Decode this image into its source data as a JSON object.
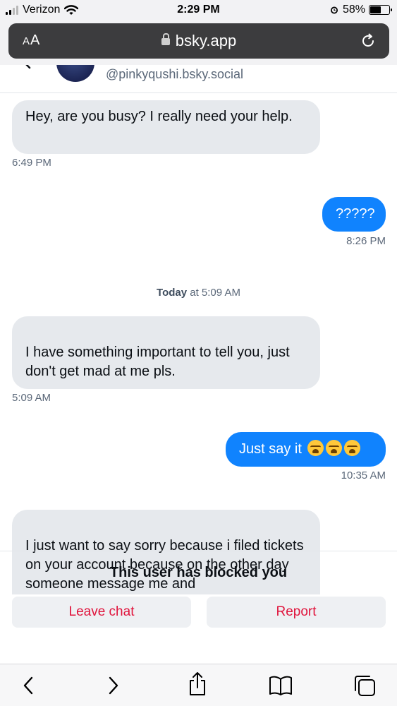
{
  "status_bar": {
    "carrier": "Verizon",
    "time": "2:29 PM",
    "battery": "58%",
    "battery_level": 0.58
  },
  "browser": {
    "text_size_label": "AA",
    "url": "bsky.app"
  },
  "conversation": {
    "handle": "@pinkyqushi.bsky.social"
  },
  "messages": [
    {
      "from": "them",
      "text": "Hey, are you busy? I really need your help.",
      "time": "6:49 PM"
    },
    {
      "from": "me",
      "text": "?????",
      "time": "8:26 PM"
    },
    {
      "from": "them",
      "text": "I have something important to tell you, just don't get mad at me pls.",
      "time": "5:09 AM"
    },
    {
      "from": "me",
      "text": "Just say it",
      "time": "10:35 AM"
    },
    {
      "from": "them",
      "text": "I just want to say sorry because i filed tickets on your account because on the other day someone message me and"
    }
  ],
  "date_divider": {
    "day": "Today",
    "rest": "at 5:09 AM"
  },
  "footer": {
    "blocked_notice": "This user has blocked you",
    "leave_label": "Leave chat",
    "report_label": "Report"
  },
  "colors": {
    "accent_blue": "#1083fe",
    "destructive": "#e0143c",
    "incoming_bubble": "#e6e9ed"
  },
  "icons": [
    "wifi-icon",
    "lock-icon",
    "reload-icon",
    "back-arrow-icon",
    "sob-emoji-icon",
    "nav-back-icon",
    "nav-forward-icon",
    "share-icon",
    "bookmarks-icon",
    "tabs-icon"
  ]
}
